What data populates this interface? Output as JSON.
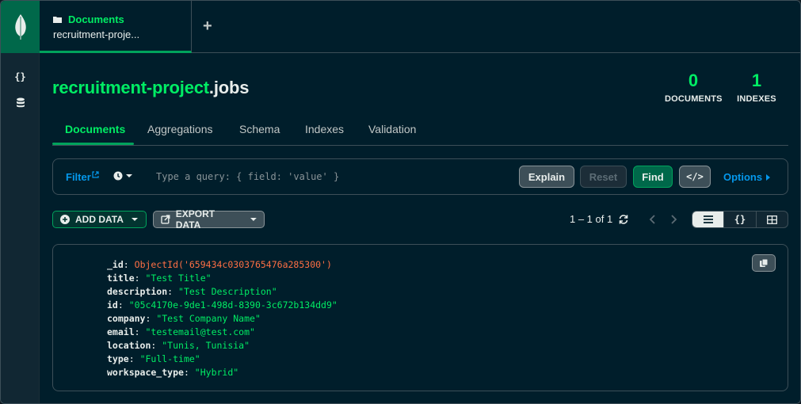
{
  "tab": {
    "type_label": "Documents",
    "namespace": "recruitment-proje..."
  },
  "header": {
    "db_name": "recruitment-project",
    "coll_name": ".jobs"
  },
  "stats": [
    {
      "value": "0",
      "label": "DOCUMENTS"
    },
    {
      "value": "1",
      "label": "INDEXES"
    }
  ],
  "subtabs": [
    "Documents",
    "Aggregations",
    "Schema",
    "Indexes",
    "Validation"
  ],
  "query": {
    "filter_label": "Filter",
    "placeholder": "Type a query: { field: 'value' }",
    "explain": "Explain",
    "reset": "Reset",
    "find": "Find",
    "code": "</>",
    "options": "Options"
  },
  "toolbar": {
    "add_data": "ADD DATA",
    "export_data": "EXPORT DATA",
    "pagination": "1 – 1 of 1"
  },
  "view_modes": {
    "list": "≡",
    "json": "{}",
    "table": "⊞"
  },
  "document": {
    "fields": [
      {
        "key": "_id",
        "value": "ObjectId('659434c0303765476a285300')",
        "type": "oid"
      },
      {
        "key": "title",
        "value": "\"Test Title\"",
        "type": "str"
      },
      {
        "key": "description",
        "value": "\"Test Description\"",
        "type": "str"
      },
      {
        "key": "id",
        "value": "\"05c4170e-9de1-498d-8390-3c672b134dd9\"",
        "type": "str"
      },
      {
        "key": "company",
        "value": "\"Test Company Name\"",
        "type": "str"
      },
      {
        "key": "email",
        "value": "\"testemail@test.com\"",
        "type": "str"
      },
      {
        "key": "location",
        "value": "\"Tunis, Tunisia\"",
        "type": "str"
      },
      {
        "key": "type",
        "value": "\"Full-time\"",
        "type": "str"
      },
      {
        "key": "workspace_type",
        "value": "\"Hybrid\"",
        "type": "str"
      }
    ]
  },
  "colors": {
    "accent": "#00ed64",
    "link": "#0498ec",
    "objectid": "#ff6f44",
    "background": "#001e2b"
  }
}
